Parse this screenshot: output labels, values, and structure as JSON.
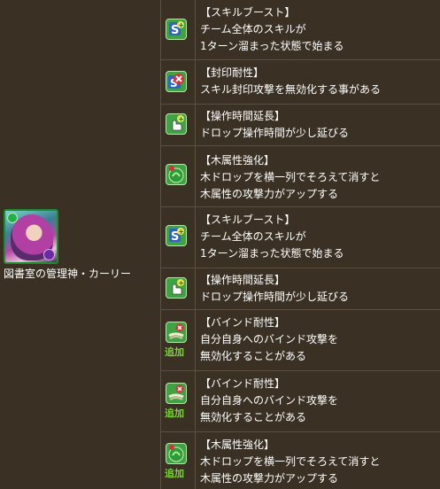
{
  "monster": {
    "name": "図書室の管理神・カーリー"
  },
  "awakenings": [
    {
      "icon": "skill-boost-icon",
      "title": "【スキルブースト】",
      "lines": [
        "チーム全体のスキルが",
        "1ターン溜まった状態で始まる"
      ],
      "badge": ""
    },
    {
      "icon": "seal-resist-icon",
      "title": "【封印耐性】",
      "lines": [
        "スキル封印攻撃を無効化する事がある"
      ],
      "badge": ""
    },
    {
      "icon": "extend-time-icon",
      "title": "【操作時間延長】",
      "lines": [
        "ドロップ操作時間が少し延びる"
      ],
      "badge": ""
    },
    {
      "icon": "wood-row-icon",
      "title": "【木属性強化】",
      "lines": [
        "木ドロップを横一列でそろえて消すと",
        "木属性の攻撃力がアップする"
      ],
      "badge": ""
    },
    {
      "icon": "skill-boost-icon",
      "title": "【スキルブースト】",
      "lines": [
        "チーム全体のスキルが",
        "1ターン溜まった状態で始まる"
      ],
      "badge": ""
    },
    {
      "icon": "extend-time-icon",
      "title": "【操作時間延長】",
      "lines": [
        "ドロップ操作時間が少し延びる"
      ],
      "badge": ""
    },
    {
      "icon": "bind-resist-icon",
      "title": "【バインド耐性】",
      "lines": [
        "自分自身へのバインド攻撃を",
        "無効化することがある"
      ],
      "badge": "追加"
    },
    {
      "icon": "bind-resist-icon",
      "title": "【バインド耐性】",
      "lines": [
        "自分自身へのバインド攻撃を",
        "無効化することがある"
      ],
      "badge": "追加"
    },
    {
      "icon": "wood-row-icon",
      "title": "【木属性強化】",
      "lines": [
        "木ドロップを横一列でそろえて消すと",
        "木属性の攻撃力がアップする"
      ],
      "badge": "追加"
    }
  ]
}
